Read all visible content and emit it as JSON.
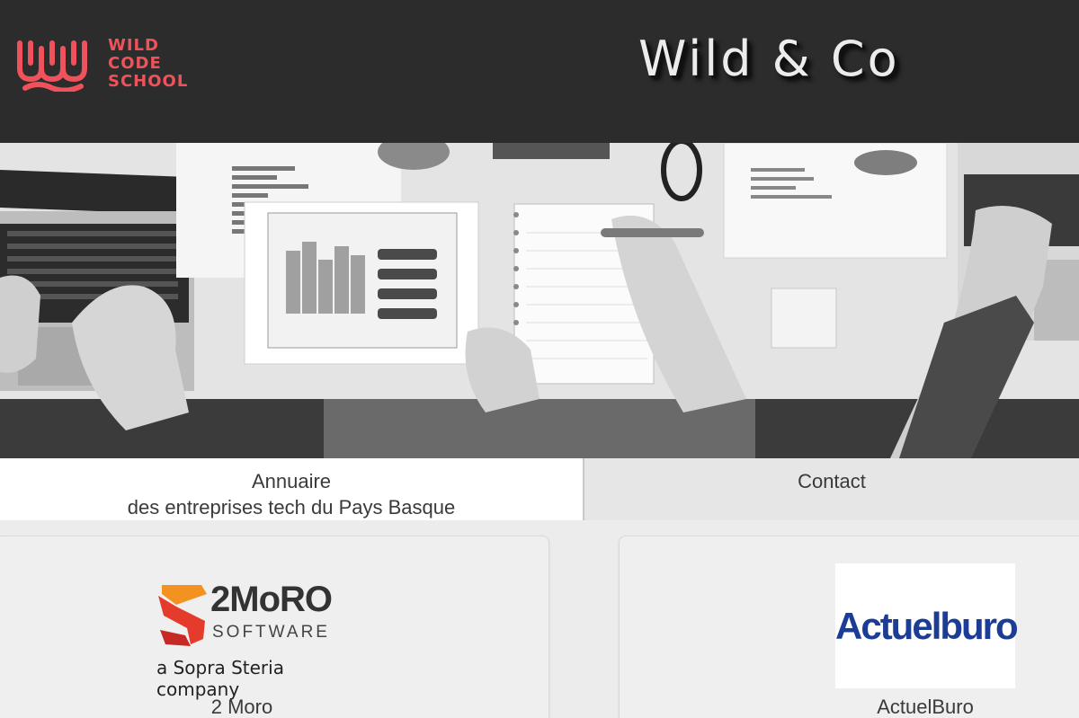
{
  "header": {
    "logo_lines": [
      "WILD",
      "CODE",
      "SCHOOL"
    ],
    "site_title": "Wild & Co"
  },
  "nav": {
    "annuaire_line1": "Annuaire",
    "annuaire_line2": "des entreprises tech du Pays Basque",
    "contact": "Contact"
  },
  "companies": [
    {
      "name": "2 Moro",
      "logo_word": "2MoRO",
      "logo_sub": "SOFTWARE",
      "logo_tagline": "a Sopra Steria company"
    },
    {
      "name": "ActuelBuro",
      "logo_word": "Actuelburo"
    }
  ],
  "colors": {
    "header_bg": "#2d2c2c",
    "brand_red": "#f0525b",
    "title_text": "#ececec",
    "actuelburo_blue": "#1d3c96",
    "moro_red": "#e53b2d",
    "moro_orange": "#f39221"
  }
}
